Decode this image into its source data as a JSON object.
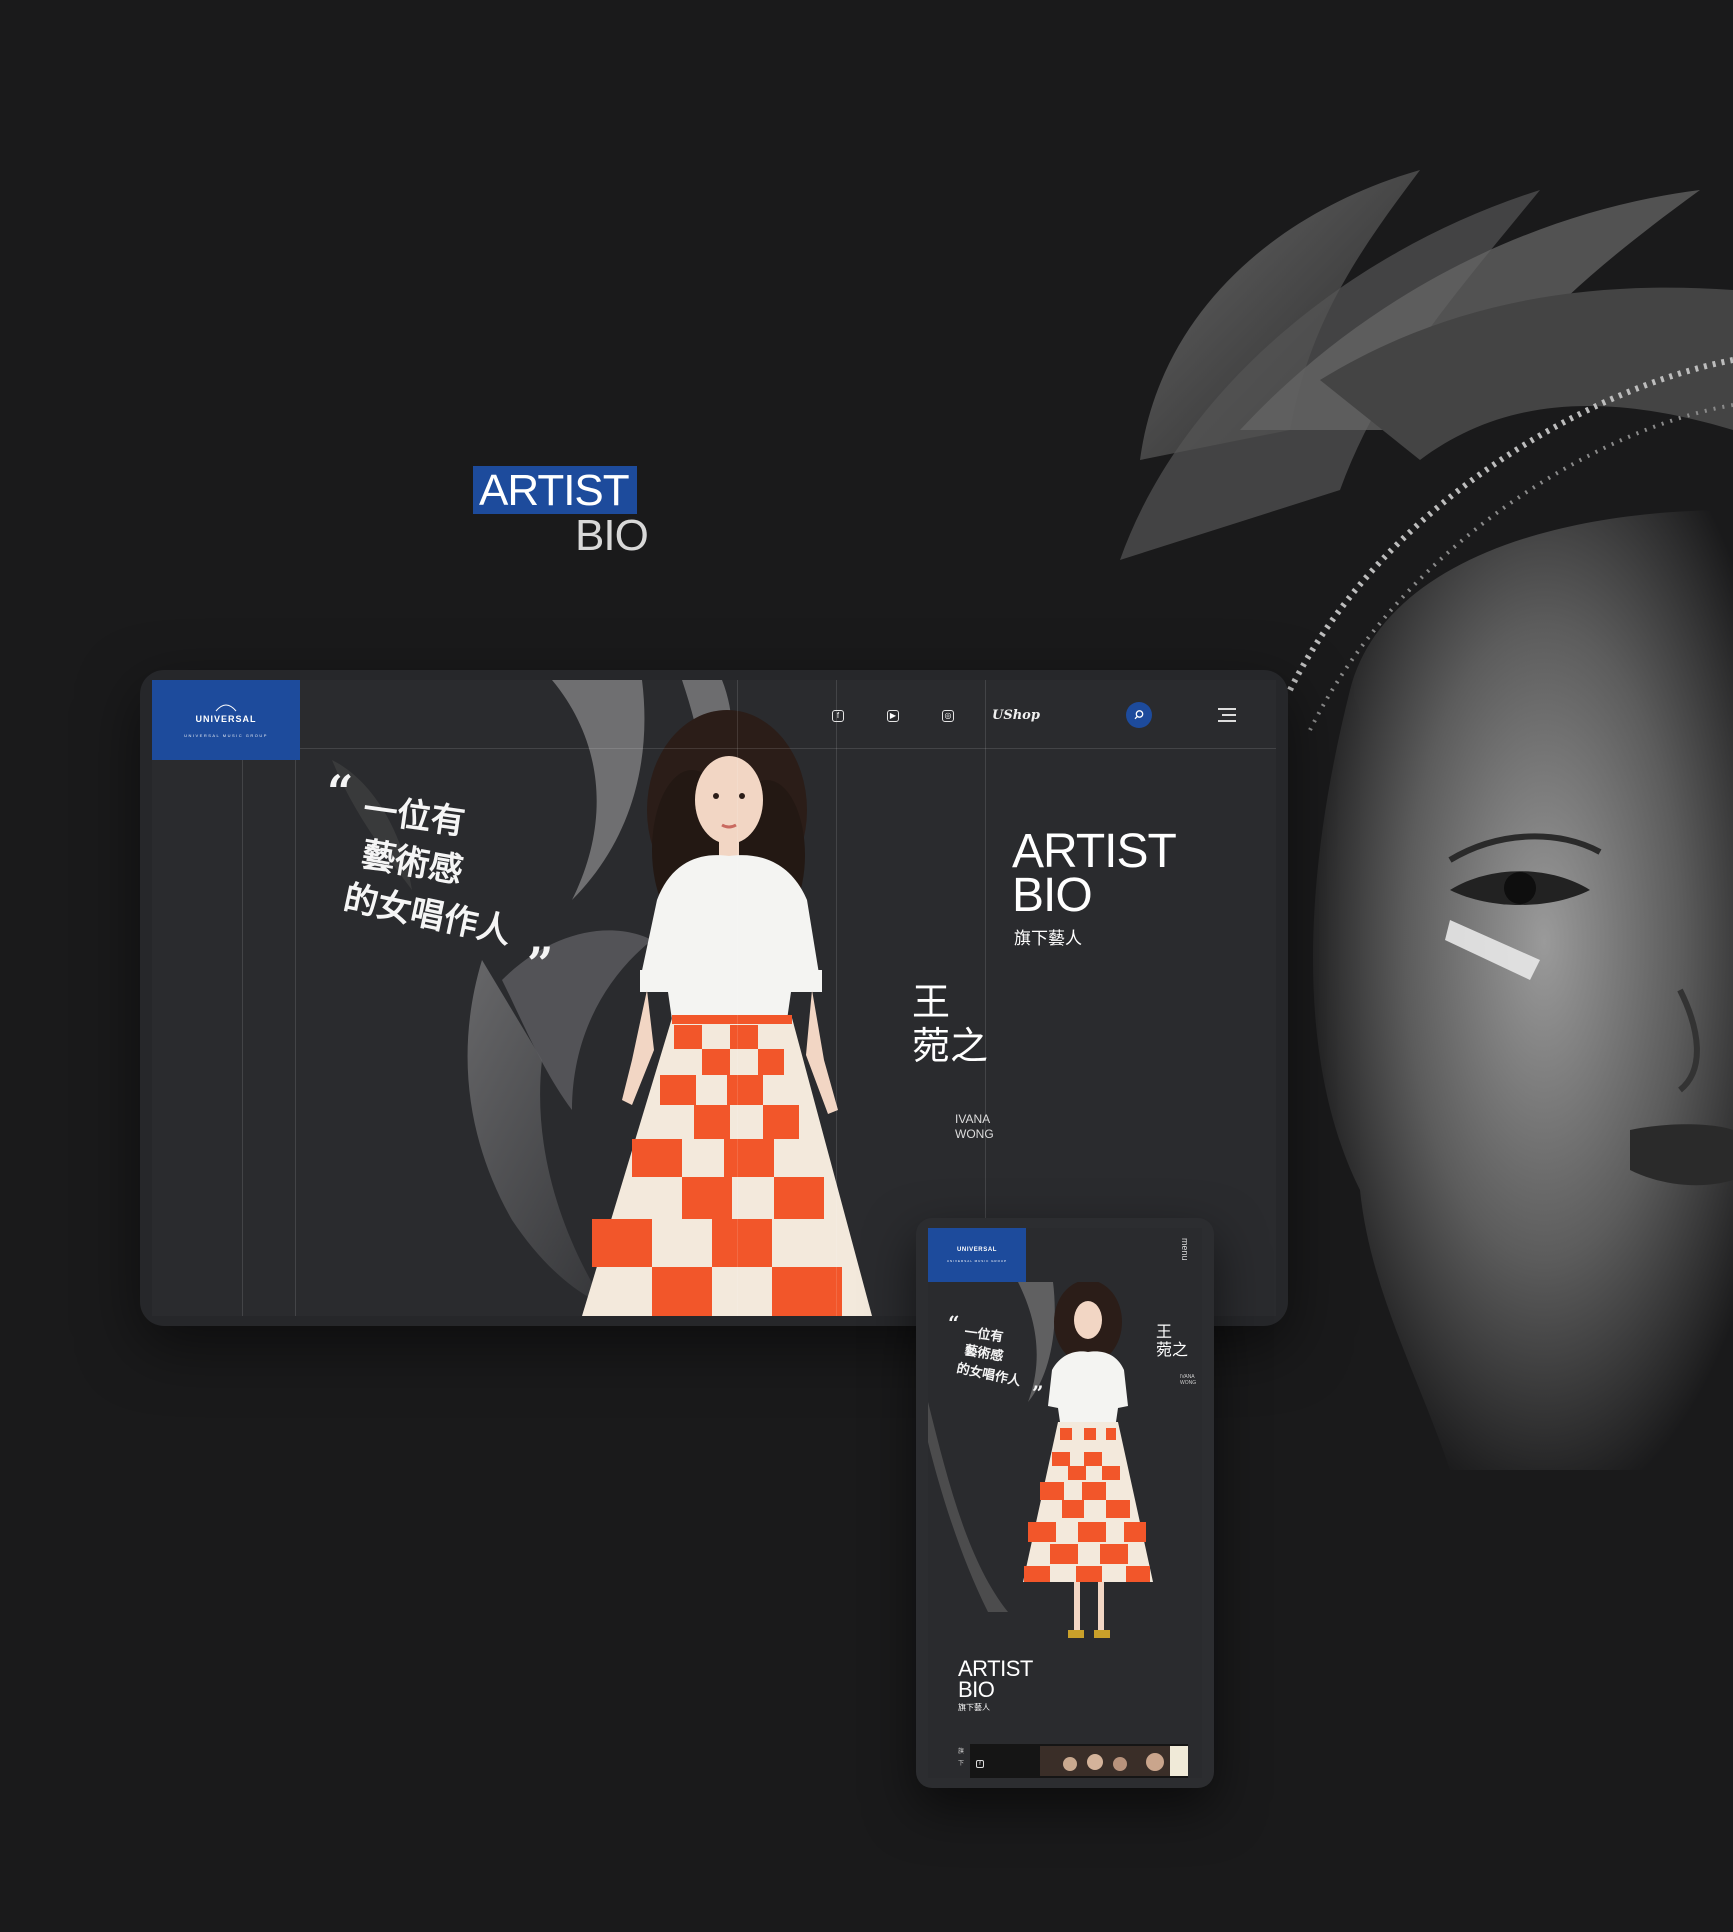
{
  "hero_label": {
    "title": "ARTIST",
    "subtitle": "BIO"
  },
  "desktop": {
    "logo": {
      "brand": "UNIVERSAL",
      "group": "UNIVERSAL MUSIC GROUP"
    },
    "nav": {
      "facebook": "f",
      "youtube": "▶",
      "instagram": "◎",
      "ushop": "UShop",
      "search_icon": "search-icon",
      "menu_icon": "hamburger-icon"
    },
    "quote_calligraphy": "一位有藝術感的女唱作人",
    "title_line1": "ARTIST",
    "title_line2": "BIO",
    "title_cn": "旗下藝人",
    "artist_name_cn_1": "王",
    "artist_name_cn_2": "菀之",
    "artist_name_en_1": "IVANA",
    "artist_name_en_2": "WONG"
  },
  "mobile": {
    "logo": {
      "brand": "UNIVERSAL",
      "group": "UNIVERSAL MUSIC GROUP"
    },
    "menu_label": "menu",
    "artist_name_cn_1": "王",
    "artist_name_cn_2": "菀之",
    "artist_name_en_1": "IVANA",
    "artist_name_en_2": "WONG",
    "title_line1": "ARTIST",
    "title_line2": "BIO",
    "title_cn": "旗下藝人",
    "side_cn": "旗下",
    "facebook": "f"
  },
  "colors": {
    "background": "#1a1a1b",
    "brand_blue": "#1d4b9c",
    "skirt_orange": "#f2562a",
    "skirt_cream": "#f3e9dc"
  }
}
